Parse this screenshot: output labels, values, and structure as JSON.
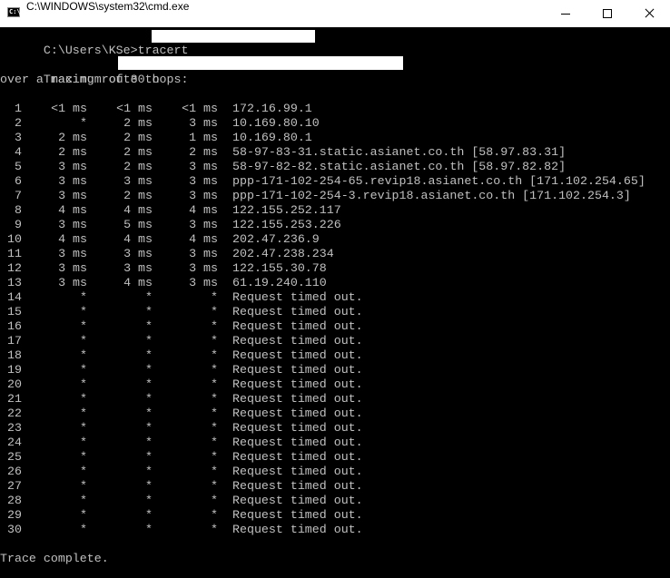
{
  "window": {
    "title": "C:\\WINDOWS\\system32\\cmd.exe",
    "icon": "cmd-icon",
    "icon_text": "C:\\"
  },
  "console": {
    "prompt": "C:\\Users\\KSe>tracert",
    "tracing_prefix": "Tracing route to",
    "max_hops_line": "over a maximum of 30 hops:",
    "hops": [
      {
        "hop": "1",
        "t1": "<1 ms",
        "t2": "<1 ms",
        "t3": "<1 ms",
        "host": "172.16.99.1"
      },
      {
        "hop": "2",
        "t1": "*",
        "t2": "2 ms",
        "t3": "3 ms",
        "host": "10.169.80.10"
      },
      {
        "hop": "3",
        "t1": "2 ms",
        "t2": "2 ms",
        "t3": "1 ms",
        "host": "10.169.80.1"
      },
      {
        "hop": "4",
        "t1": "2 ms",
        "t2": "2 ms",
        "t3": "2 ms",
        "host": "58-97-83-31.static.asianet.co.th [58.97.83.31]"
      },
      {
        "hop": "5",
        "t1": "3 ms",
        "t2": "2 ms",
        "t3": "3 ms",
        "host": "58-97-82-82.static.asianet.co.th [58.97.82.82]"
      },
      {
        "hop": "6",
        "t1": "3 ms",
        "t2": "3 ms",
        "t3": "3 ms",
        "host": "ppp-171-102-254-65.revip18.asianet.co.th [171.102.254.65]"
      },
      {
        "hop": "7",
        "t1": "3 ms",
        "t2": "2 ms",
        "t3": "3 ms",
        "host": "ppp-171-102-254-3.revip18.asianet.co.th [171.102.254.3]"
      },
      {
        "hop": "8",
        "t1": "4 ms",
        "t2": "4 ms",
        "t3": "4 ms",
        "host": "122.155.252.117"
      },
      {
        "hop": "9",
        "t1": "3 ms",
        "t2": "5 ms",
        "t3": "3 ms",
        "host": "122.155.253.226"
      },
      {
        "hop": "10",
        "t1": "4 ms",
        "t2": "4 ms",
        "t3": "4 ms",
        "host": "202.47.236.9"
      },
      {
        "hop": "11",
        "t1": "3 ms",
        "t2": "3 ms",
        "t3": "3 ms",
        "host": "202.47.238.234"
      },
      {
        "hop": "12",
        "t1": "3 ms",
        "t2": "3 ms",
        "t3": "3 ms",
        "host": "122.155.30.78"
      },
      {
        "hop": "13",
        "t1": "3 ms",
        "t2": "4 ms",
        "t3": "3 ms",
        "host": "61.19.240.110"
      },
      {
        "hop": "14",
        "t1": "*",
        "t2": "*",
        "t3": "*",
        "host": "Request timed out."
      },
      {
        "hop": "15",
        "t1": "*",
        "t2": "*",
        "t3": "*",
        "host": "Request timed out."
      },
      {
        "hop": "16",
        "t1": "*",
        "t2": "*",
        "t3": "*",
        "host": "Request timed out."
      },
      {
        "hop": "17",
        "t1": "*",
        "t2": "*",
        "t3": "*",
        "host": "Request timed out."
      },
      {
        "hop": "18",
        "t1": "*",
        "t2": "*",
        "t3": "*",
        "host": "Request timed out."
      },
      {
        "hop": "19",
        "t1": "*",
        "t2": "*",
        "t3": "*",
        "host": "Request timed out."
      },
      {
        "hop": "20",
        "t1": "*",
        "t2": "*",
        "t3": "*",
        "host": "Request timed out."
      },
      {
        "hop": "21",
        "t1": "*",
        "t2": "*",
        "t3": "*",
        "host": "Request timed out."
      },
      {
        "hop": "22",
        "t1": "*",
        "t2": "*",
        "t3": "*",
        "host": "Request timed out."
      },
      {
        "hop": "23",
        "t1": "*",
        "t2": "*",
        "t3": "*",
        "host": "Request timed out."
      },
      {
        "hop": "24",
        "t1": "*",
        "t2": "*",
        "t3": "*",
        "host": "Request timed out."
      },
      {
        "hop": "25",
        "t1": "*",
        "t2": "*",
        "t3": "*",
        "host": "Request timed out."
      },
      {
        "hop": "26",
        "t1": "*",
        "t2": "*",
        "t3": "*",
        "host": "Request timed out."
      },
      {
        "hop": "27",
        "t1": "*",
        "t2": "*",
        "t3": "*",
        "host": "Request timed out."
      },
      {
        "hop": "28",
        "t1": "*",
        "t2": "*",
        "t3": "*",
        "host": "Request timed out."
      },
      {
        "hop": "29",
        "t1": "*",
        "t2": "*",
        "t3": "*",
        "host": "Request timed out."
      },
      {
        "hop": "30",
        "t1": "*",
        "t2": "*",
        "t3": "*",
        "host": "Request timed out."
      }
    ],
    "complete": "Trace complete."
  },
  "colors": {
    "console_bg": "#000000",
    "console_fg": "#c0c0c0",
    "titlebar_bg": "#ffffff"
  }
}
